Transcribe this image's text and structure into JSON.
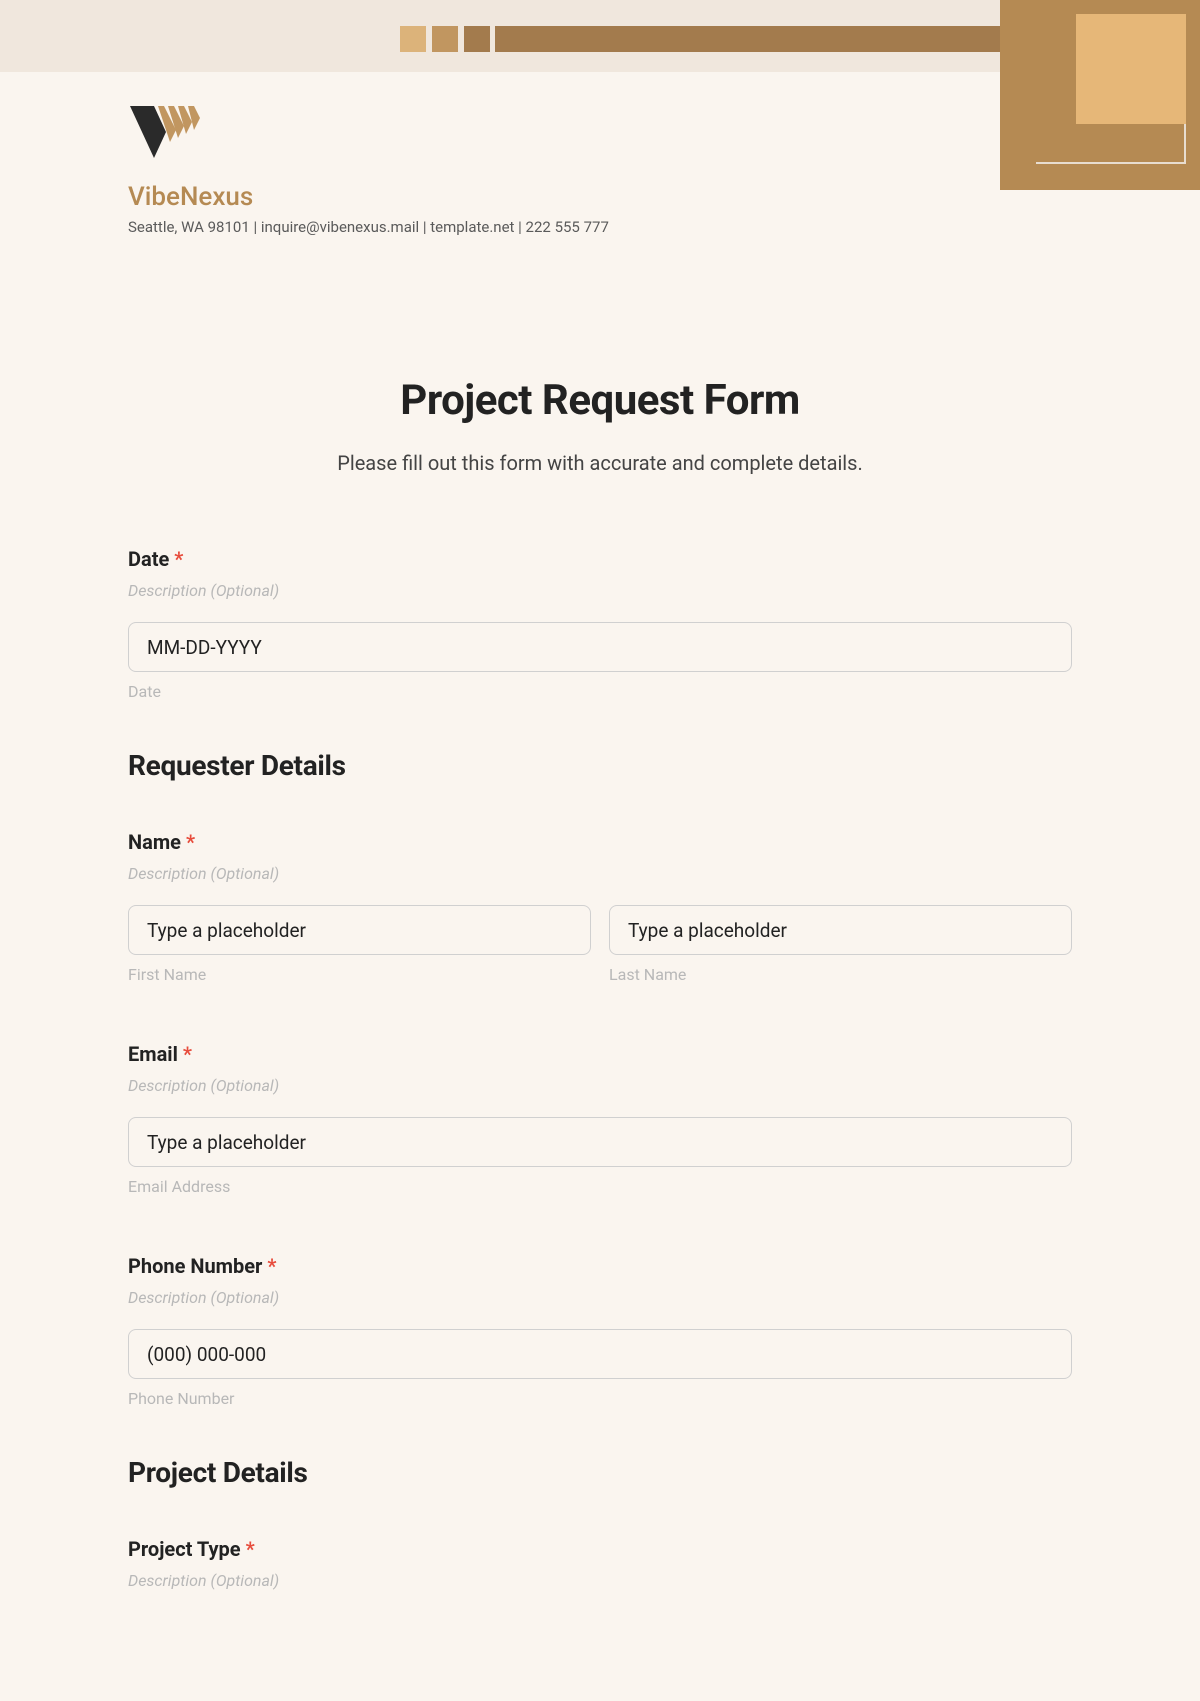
{
  "brand": {
    "name": "VibeNexus",
    "contact": "Seattle, WA 98101 | inquire@vibenexus.mail | template.net | 222 555 777"
  },
  "form": {
    "title": "Project Request Form",
    "subtitle": "Please fill out this form with accurate and complete details."
  },
  "fields": {
    "date": {
      "label": "Date",
      "desc": "Description (Optional)",
      "placeholder": "MM-DD-YYYY",
      "sublabel": "Date"
    },
    "requester_section": "Requester Details",
    "name": {
      "label": "Name",
      "desc": "Description (Optional)",
      "first_placeholder": "Type a placeholder",
      "last_placeholder": "Type a placeholder",
      "first_sublabel": "First Name",
      "last_sublabel": "Last Name"
    },
    "email": {
      "label": "Email",
      "desc": "Description (Optional)",
      "placeholder": "Type a placeholder",
      "sublabel": "Email Address"
    },
    "phone": {
      "label": "Phone Number",
      "desc": "Description (Optional)",
      "placeholder": "(000) 000-000",
      "sublabel": "Phone Number"
    },
    "project_section": "Project Details",
    "project_type": {
      "label": "Project Type",
      "desc": "Description (Optional)"
    }
  },
  "asterisk": "*"
}
